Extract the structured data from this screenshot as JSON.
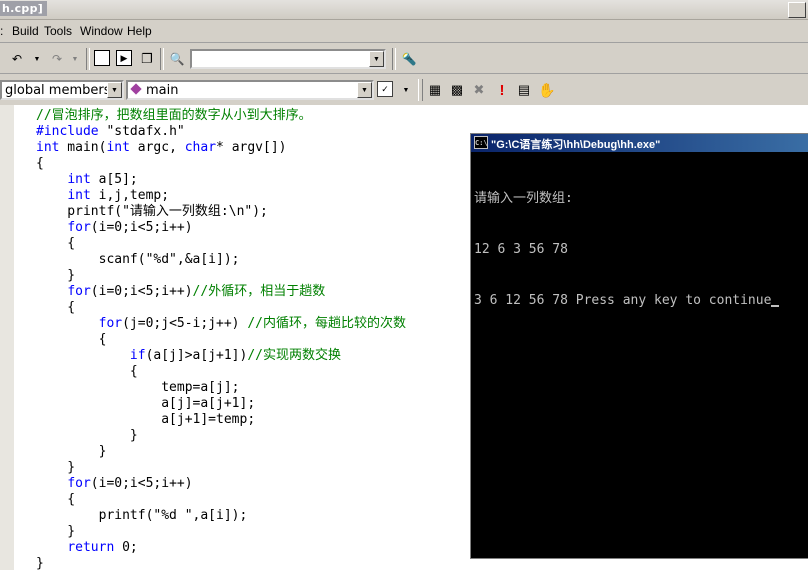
{
  "window": {
    "title": "h.cpp]"
  },
  "menu": [
    {
      "label": "Build"
    },
    {
      "label": "Tools"
    },
    {
      "label": "Window"
    },
    {
      "label": "Help"
    }
  ],
  "toolbar": {
    "find_combo_value": "",
    "members_combo_value": "global members",
    "function_combo_value": "main"
  },
  "code_lines": [
    "//冒泡排序，把数组里面的数字从小到大排序。",
    "#include \"stdafx.h\"",
    "int main(int argc, char* argv[])",
    "{",
    "    int a[5];",
    "    int i,j,temp;",
    "    printf(\"请输入一列数组:\\n\");",
    "    for(i=0;i<5;i++)",
    "    {",
    "        scanf(\"%d\",&a[i]);",
    "    }",
    "    for(i=0;i<5;i++)//外循环，相当于趟数",
    "    {",
    "        for(j=0;j<5-i;j++) //内循环，每趟比较的次数",
    "        {",
    "            if(a[j]>a[j+1])//实现两数交换",
    "            {",
    "                temp=a[j];",
    "                a[j]=a[j+1];",
    "                a[j+1]=temp;",
    "            }",
    "        }",
    "    }",
    "    for(i=0;i<5;i++)",
    "    {",
    "        printf(\"%d \",a[i]);",
    "    }",
    "    return 0;",
    "}"
  ],
  "console": {
    "title": "\"G:\\C语言练习\\hh\\Debug\\hh.exe\"",
    "icon_label": "C:\\",
    "lines": [
      "请输入一列数组:",
      "12 6 3 56 78",
      "3 6 12 56 78 Press any key to continue"
    ]
  },
  "icons": [
    "undo-icon",
    "redo-icon",
    "workspace-icon",
    "output-icon",
    "window-list-icon",
    "find-in-files-icon",
    "find-icon",
    "class-wizard-icon",
    "compile-icon",
    "build-icon",
    "stop-build-icon",
    "execute-icon",
    "go-icon",
    "breakpoint-icon"
  ]
}
